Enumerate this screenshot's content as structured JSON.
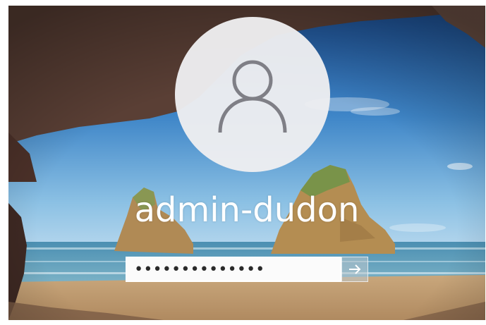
{
  "lock_screen": {
    "username": "admin-dudon",
    "password_masked": "••••••••••••••"
  },
  "icons": {
    "avatar": "user-silhouette-icon",
    "submit": "arrow-right-icon"
  },
  "colors": {
    "avatar_circle": "#eeeef0",
    "avatar_outline": "#7f7f86",
    "username_text": "#ffffff",
    "password_bg": "#fbfbfb"
  }
}
